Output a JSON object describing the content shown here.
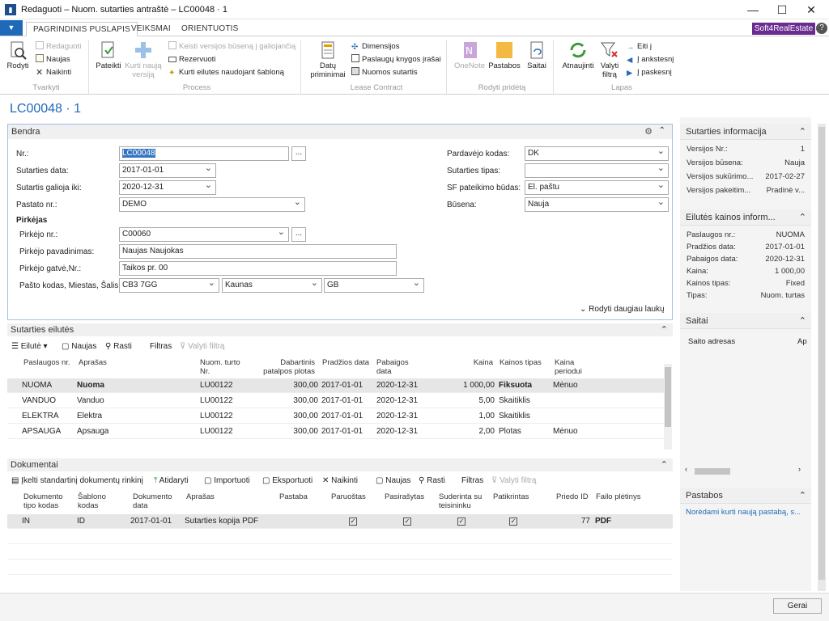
{
  "window": {
    "title": "Redaguoti – Nuom. sutarties antraštė – LC00048 · 1",
    "min": "—",
    "max": "☐",
    "close": "✕"
  },
  "tabs": [
    "PAGRINDINIS PUSLAPIS",
    "VEIKSMAI",
    "ORIENTUOTIS"
  ],
  "brand": "Soft4RealEstate",
  "help": "?",
  "ribbon": {
    "tvarkyti": {
      "label": "Tvarkyti",
      "rodyti": "Rodyti",
      "redaguoti": "Redaguoti",
      "naujas": "Naujas",
      "naikinti": "Naikinti"
    },
    "process": {
      "label": "Process",
      "pateikti": "Pateikti",
      "kurti1": "Kurti naują",
      "kurti2": "versiją",
      "keisti": "Keisti versijos būseną į galiojančią",
      "rezervuoti": "Rezervuoti",
      "kurti_eil": "Kurti eilutes naudojant šabloną"
    },
    "lease": {
      "label": "Lease Contract",
      "datu1": "Datų",
      "datu2": "priminimai",
      "dimensijos": "Dimensijos",
      "paslaugu": "Paslaugų knygos įrašai",
      "nuomos": "Nuomos sutartis"
    },
    "rodyti": {
      "label": "Rodyti pridėtą",
      "onenote": "OneNote",
      "pastabos": "Pastabos",
      "saitai": "Saitai"
    },
    "lapas": {
      "label": "Lapas",
      "atnaujinti": "Atnaujinti",
      "valyti1": "Valyti",
      "valyti2": "filtrą",
      "eiti": "Eiti į",
      "ankstesnis": "Į ankstesnį",
      "paskesnis": "Į paskesnį"
    }
  },
  "page_title": "LC00048 · 1",
  "bendra": {
    "title": "Bendra",
    "nr_label": "Nr.:",
    "nr": "LC00048",
    "sutarties_data_label": "Sutarties data:",
    "sutarties_data": "2017-01-01",
    "galioja_label": "Sutartis galioja iki:",
    "galioja": "2020-12-31",
    "pastato_label": "Pastato nr.:",
    "pastato": "DEMO",
    "pirkejas_label": "Pirkėjas",
    "pirkejo_nr_label": "Pirkėjo nr.:",
    "pirkejo_nr": "C00060",
    "pirkejo_pav_label": "Pirkėjo pavadinimas:",
    "pirkejo_pav": "Naujas Naujokas",
    "pirkejo_gatve_label": "Pirkėjo gatvė,Nr.:",
    "pirkejo_gatve": "Taikos pr. 00",
    "pasto_label": "Pašto kodas, Miestas, Šalis:",
    "pasto": "CB3 7GG",
    "miestas": "Kaunas",
    "salis": "GB",
    "pardavejo_label": "Pardavėjo kodas:",
    "pardavejo": "DK",
    "tipas_label": "Sutarties tipas:",
    "tipas": "",
    "sf_label": "SF pateikimo būdas:",
    "sf": "El. paštu",
    "busena_label": "Būsena:",
    "busena": "Nauja",
    "daugiau": "Rodyti daugiau laukų",
    "lookup": "..."
  },
  "eilutes": {
    "title": "Sutarties eilutės",
    "toolbar": {
      "eilute": "Eilutė",
      "naujas": "Naujas",
      "rasti": "Rasti",
      "filtras": "Filtras",
      "valyti": "Valyti filtrą"
    },
    "headers": {
      "nr": "Paslaugos nr.",
      "aprasas": "Aprašas",
      "turto1": "Nuom. turto",
      "turto2": "Nr.",
      "plotas1": "Dabartinis",
      "plotas2": "patalpos plotas",
      "pradzios": "Pradžios data",
      "pab1": "Pabaigos",
      "pab2": "data",
      "kaina": "Kaina",
      "kainos_tipas": "Kainos tipas",
      "per1": "Kaina",
      "per2": "periodui"
    },
    "rows": [
      {
        "nr": "NUOMA",
        "aprasas": "Nuoma",
        "turto": "LU00122",
        "plotas": "300,00",
        "pradzios": "2017-01-01",
        "pab": "2020-12-31",
        "kaina": "1 000,00",
        "tipas": "Fiksuota",
        "periodas": "Mėnuo"
      },
      {
        "nr": "VANDUO",
        "aprasas": "Vanduo",
        "turto": "LU00122",
        "plotas": "300,00",
        "pradzios": "2017-01-01",
        "pab": "2020-12-31",
        "kaina": "5,00",
        "tipas": "Skaitiklis",
        "periodas": ""
      },
      {
        "nr": "ELEKTRA",
        "aprasas": "Elektra",
        "turto": "LU00122",
        "plotas": "300,00",
        "pradzios": "2017-01-01",
        "pab": "2020-12-31",
        "kaina": "1,00",
        "tipas": "Skaitiklis",
        "periodas": ""
      },
      {
        "nr": "APSAUGA",
        "aprasas": "Apsauga",
        "turto": "LU00122",
        "plotas": "300,00",
        "pradzios": "2017-01-01",
        "pab": "2020-12-31",
        "kaina": "2,00",
        "tipas": "Plotas",
        "periodas": "Mėnuo"
      }
    ]
  },
  "dokumentai": {
    "title": "Dokumentai",
    "toolbar": {
      "ikelti": "Įkelti standartinį dokumentų rinkinį",
      "atidaryti": "Atidaryti",
      "importuoti": "Importuoti",
      "eksportuoti": "Eksportuoti",
      "naikinti": "Naikinti",
      "naujas": "Naujas",
      "rasti": "Rasti",
      "filtras": "Filtras",
      "valyti": "Valyti filtrą"
    },
    "headers": {
      "tipas1": "Dokumento",
      "tipas2": "tipo kodas",
      "sab1": "Šablono",
      "sab2": "kodas",
      "data1": "Dokumento",
      "data2": "data",
      "aprasas": "Aprašas",
      "pastaba": "Pastaba",
      "paruostas": "Paruoštas",
      "pasirasytas": "Pasirašytas",
      "sud1": "Suderinta su",
      "sud2": "teisininku",
      "patikrintas": "Patikrintas",
      "priedo": "Priedo ID",
      "failo": "Failo plėtinys"
    },
    "rows": [
      {
        "tipas": "IN",
        "sablonas": "ID",
        "data": "2017-01-01",
        "aprasas": "Sutarties kopija PDF",
        "pastaba": "",
        "priedo": "77",
        "failo": "PDF"
      }
    ]
  },
  "factbox": {
    "info": {
      "title": "Sutarties informacija",
      "rows": [
        [
          "Versijos Nr.:",
          "1"
        ],
        [
          "Versijos būsena:",
          "Nauja"
        ],
        [
          "Versijos sukūrimo...",
          "2017-02-27"
        ],
        [
          "Versijos pakeitim...",
          "Pradinė v..."
        ]
      ]
    },
    "kaina": {
      "title": "Eilutės kainos inform...",
      "rows": [
        [
          "Paslaugos nr.:",
          "NUOMA"
        ],
        [
          "Pradžios data:",
          "2017-01-01"
        ],
        [
          "Pabaigos data:",
          "2020-12-31"
        ],
        [
          "Kaina:",
          "1 000,00"
        ],
        [
          "Kainos tipas:",
          "Fixed"
        ],
        [
          "Tipas:",
          "Nuom. turtas"
        ]
      ]
    },
    "saitai": {
      "title": "Saitai",
      "col1": "Saito adresas",
      "col2": "Ap"
    },
    "pastabos": {
      "title": "Pastabos",
      "link": "Norėdami kurti naują pastabą, s..."
    }
  },
  "ok": "Gerai"
}
